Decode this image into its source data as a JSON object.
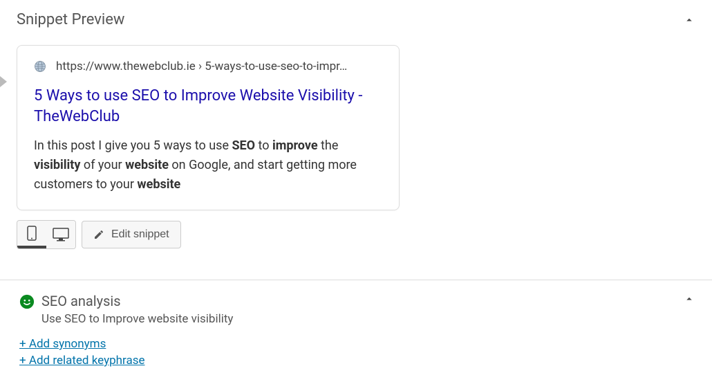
{
  "snippet_preview": {
    "section_title": "Snippet Preview",
    "url": "https://www.thewebclub.ie › 5-ways-to-use-seo-to-impr…",
    "title": "5 Ways to use SEO to Improve Website Visibility - TheWebClub",
    "desc_parts": {
      "t1": "In this post I give you 5 ways to use ",
      "b1": "SEO",
      "t2": " to ",
      "b2": "improve",
      "t3": " the ",
      "b3": "visibility",
      "t4": " of your ",
      "b4": "website",
      "t5": " on Google, and start getting more customers to your ",
      "b5": "website"
    },
    "edit_button": "Edit snippet"
  },
  "seo_analysis": {
    "section_title": "SEO analysis",
    "keyphrase": "Use SEO to Improve website visibility",
    "add_synonyms": "+ Add synonyms",
    "add_related": "+ Add related keyphrase"
  }
}
